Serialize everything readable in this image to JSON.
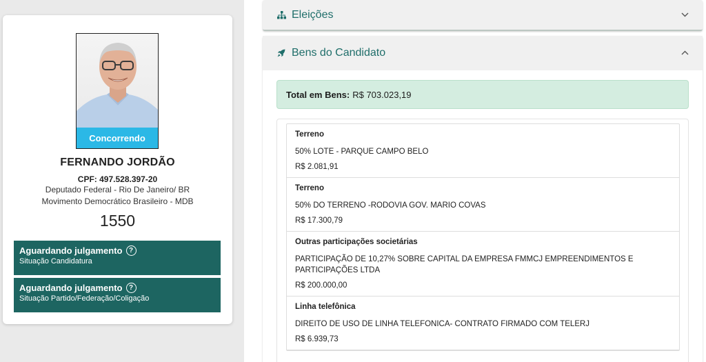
{
  "candidate": {
    "status": "Concorrendo",
    "name": "FERNANDO JORDÃO",
    "cpf": "CPF: 497.528.397-20",
    "office": "Deputado Federal - Rio De Janeiro/ BR",
    "party": "Movimento Democrático Brasileiro - MDB",
    "number": "1550",
    "judgements": [
      {
        "title": "Aguardando julgamento",
        "subtitle": "Situação Candidatura"
      },
      {
        "title": "Aguardando julgamento",
        "subtitle": "Situação Partido/Federação/Coligação"
      }
    ]
  },
  "accordions": {
    "eleicoes": {
      "title": "Eleições",
      "icon": "sitemap-icon"
    },
    "bens": {
      "title": "Bens do Candidato",
      "icon": "rocket-icon"
    }
  },
  "bens": {
    "total_label": "Total em Bens:",
    "total_value": "R$ 703.023,19",
    "items": [
      {
        "type": "Terreno",
        "description": "50% LOTE - PARQUE CAMPO BELO",
        "value": "R$ 2.081,91"
      },
      {
        "type": "Terreno",
        "description": "50% DO TERRENO -RODOVIA GOV. MARIO COVAS",
        "value": "R$ 17.300,79"
      },
      {
        "type": "Outras participações societárias",
        "description": "PARTICIPAÇÃO DE 10,27% SOBRE CAPITAL DA EMPRESA FMMCJ EMPREENDIMENTOS E PARTICIPAÇÕES LTDA",
        "value": "R$ 200.000,00"
      },
      {
        "type": "Linha telefônica",
        "description": "DIREITO DE USO DE LINHA TELEFONICA- CONTRATO FIRMADO COM TELERJ",
        "value": "R$ 6.939,73"
      }
    ]
  },
  "colors": {
    "status_band": "#2bb8e6",
    "judgement_bg": "#1d6561",
    "accent": "#1f6e6a",
    "total_bg": "#d4ede0"
  }
}
